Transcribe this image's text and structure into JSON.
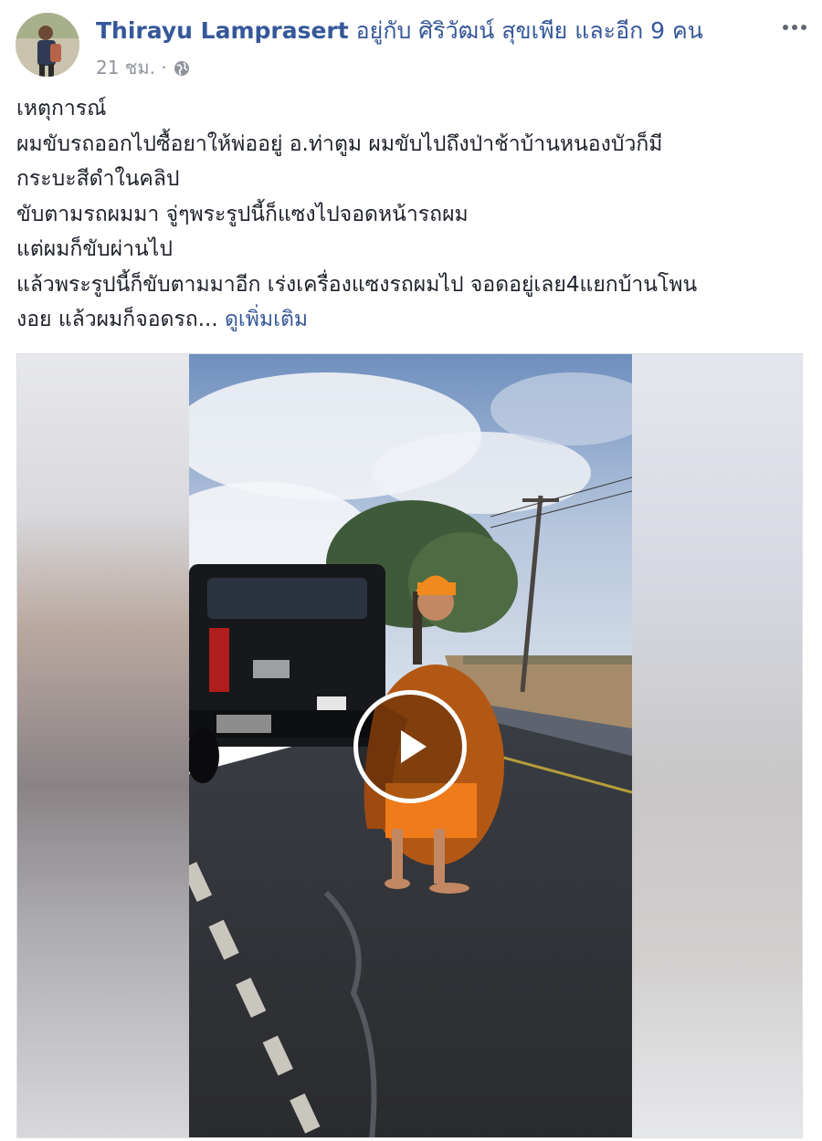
{
  "post": {
    "author": "Thirayu Lamprasert",
    "with_text": " อยู่กับ ศิริวัฒน์ สุขเพีย และอีก 9 คน",
    "timestamp": "21 ชม. ·",
    "privacy_icon": "globe-icon",
    "more_icon": "ellipsis-icon",
    "lines": [
      "เหตุการณ์",
      "ผมขับรถออกไปซื้อยาให้พ่ออยู่ อ.ท่าตูม ผมขับไปถึงป่าช้าบ้านหนองบัวก็มี",
      "กระบะสีดำในคลิป",
      "ขับตามรถผมมา จู่ๆพระรูปนี้ก็แซงไปจอดหน้ารถผม",
      "แต่ผมก็ขับผ่านไป",
      "แล้วพระรูปนี้ก็ขับตามมาอีก เร่งเครื่องแซงรถผมไป จอดอยู่เลย4แยกบ้านโพน",
      "งอย แล้วผมก็จอดรถ..."
    ],
    "see_more": "ดูเพิ่มเติม",
    "video_play_icon": "play-icon"
  }
}
